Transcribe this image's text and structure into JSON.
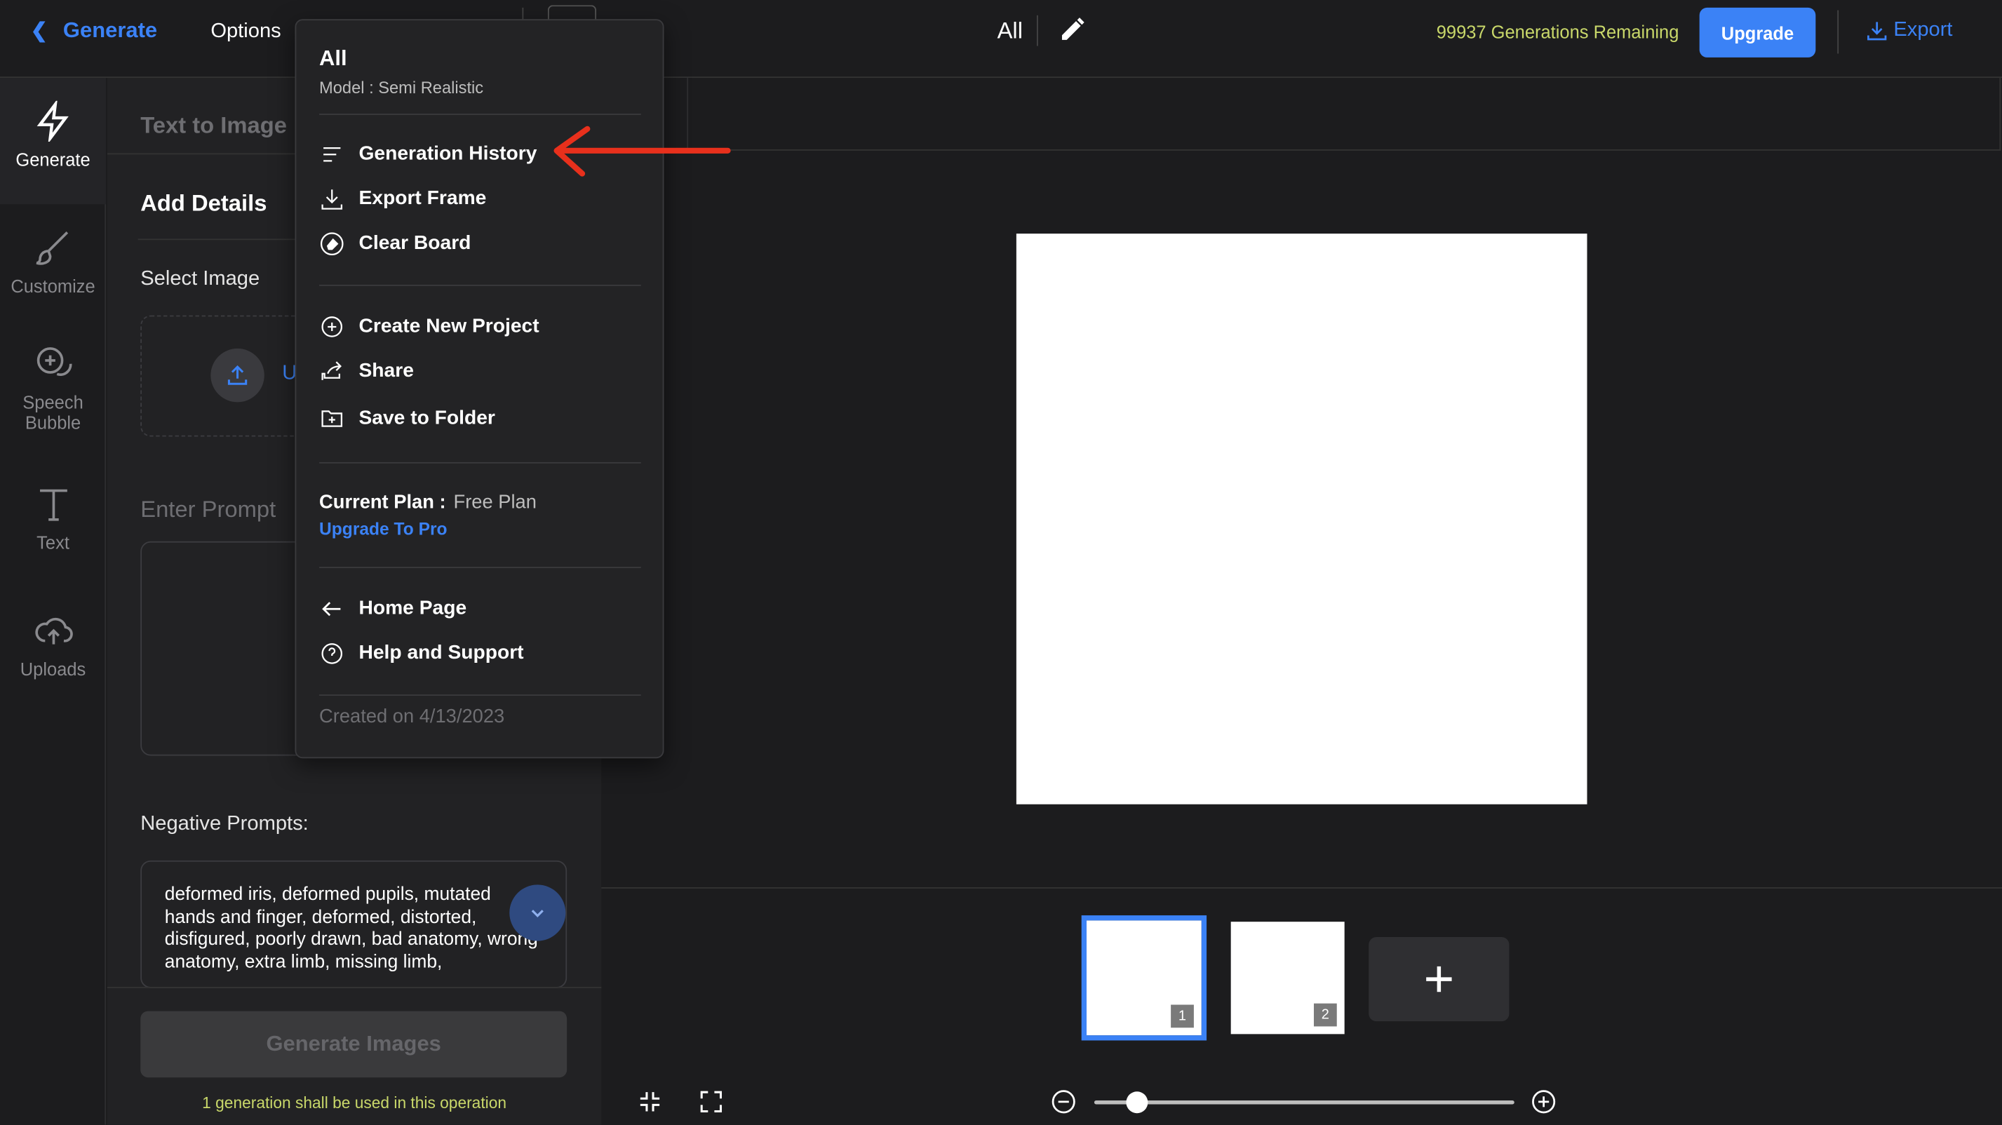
{
  "topbar": {
    "back_label": "Generate",
    "options_label": "Options",
    "project_title": "All",
    "generations_remaining": "99937 Generations Remaining",
    "upgrade_label": "Upgrade",
    "export_label": "Export"
  },
  "rail": {
    "items": [
      {
        "label": "Generate",
        "icon": "bolt-icon",
        "active": true
      },
      {
        "label": "Customize",
        "icon": "brush-icon"
      },
      {
        "label": "Speech",
        "label2": "Bubble",
        "icon": "speech-bubble-icon"
      },
      {
        "label": "Text",
        "icon": "text-icon"
      },
      {
        "label": "Uploads",
        "icon": "cloud-upload-icon"
      }
    ]
  },
  "panel": {
    "tab_label": "Text to Image",
    "add_details": "Add Details",
    "select_image": "Select Image",
    "upload_text": "U",
    "enter_prompt": "Enter Prompt",
    "negative_label": "Negative Prompts:",
    "negative_text": "deformed iris, deformed pupils, mutated hands and finger, deformed, distorted, disfigured, poorly drawn, bad anatomy, wrong anatomy, extra limb, missing limb,",
    "generate_button": "Generate Images",
    "note": "1 generation shall be used in this operation"
  },
  "canvas": {
    "thumbnails": [
      {
        "number": "1",
        "selected": true
      },
      {
        "number": "2",
        "selected": false
      }
    ],
    "zoom_level": 0.1
  },
  "menu": {
    "title": "All",
    "model": "Model : Semi Realistic",
    "items_group1": [
      "Generation History",
      "Export Frame",
      "Clear Board"
    ],
    "items_group2": [
      "Create New Project",
      "Share",
      "Save to Folder"
    ],
    "plan_label": "Current Plan :",
    "plan_value": "Free Plan",
    "upgrade_pro": "Upgrade To Pro",
    "items_group3": [
      "Home Page",
      "Help and Support"
    ],
    "created": "Created on 4/13/2023"
  },
  "colors": {
    "accent": "#3b82f6",
    "highlight_text": "#c9d86a",
    "annotation_arrow": "#e8301c"
  }
}
